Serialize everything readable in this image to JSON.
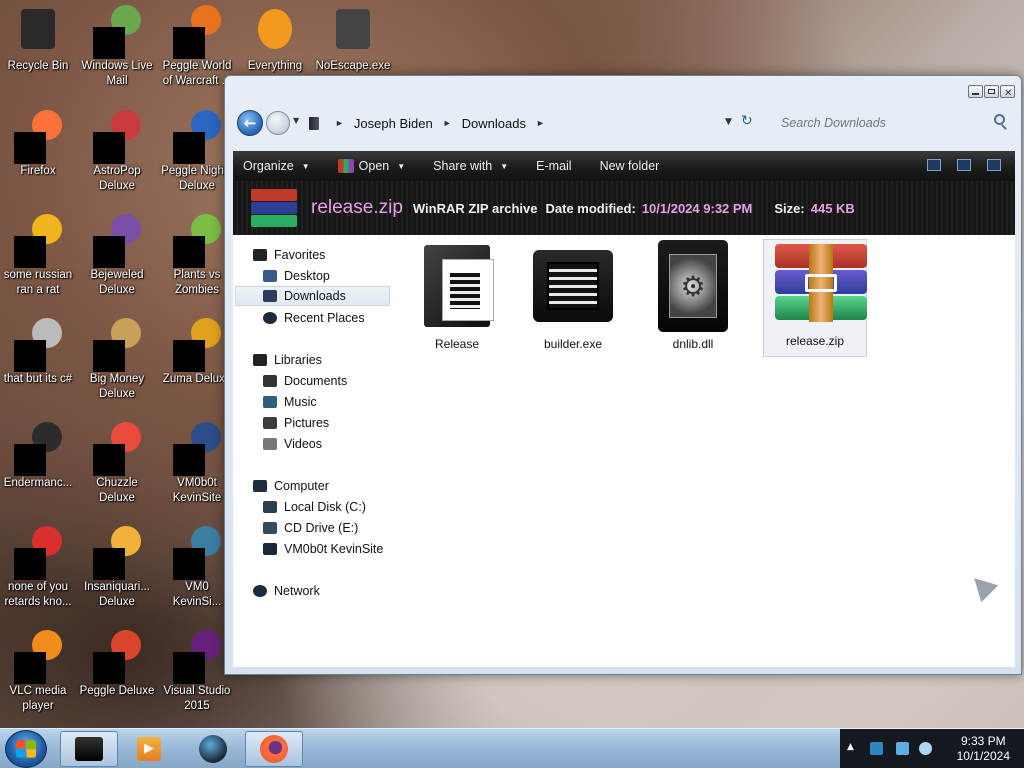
{
  "desktop": {
    "icons": [
      {
        "label": "Recycle Bin",
        "color": "#2a2a2a"
      },
      {
        "label": "Windows Live\nMail",
        "color": "#6aa84f"
      },
      {
        "label": "Peggle World\nof Warcraft ...",
        "color": "#e8731c"
      },
      {
        "label": "Everything",
        "color": "#f39a1e"
      },
      {
        "label": "NoEscape.exe",
        "color": "#444444"
      },
      {
        "label": "Firefox",
        "color": "#ff7139"
      },
      {
        "label": "AstroPop\nDeluxe",
        "color": "#cc3b3b"
      },
      {
        "label": "Peggle Nights\nDeluxe",
        "color": "#2b66c2"
      },
      {
        "label": "some russian\nran a rat",
        "color": "#f0b41c"
      },
      {
        "label": "Bejeweled\nDeluxe",
        "color": "#7b4fa8"
      },
      {
        "label": "Plants vs\nZombies",
        "color": "#7bbd45"
      },
      {
        "label": "that but its c#",
        "color": "#bbbbbb"
      },
      {
        "label": "Big Money\nDeluxe",
        "color": "#c7a05a"
      },
      {
        "label": "Zuma Deluxe",
        "color": "#e0a21c"
      },
      {
        "label": "Endermanc...",
        "color": "#2c2c2c"
      },
      {
        "label": "Chuzzle\nDeluxe",
        "color": "#e84b3c"
      },
      {
        "label": "VM0b0t\nKevinSite",
        "color": "#2c4d8a"
      },
      {
        "label": "none of you\nretards kno...",
        "color": "#d9302f"
      },
      {
        "label": "Insaniquari...\nDeluxe",
        "color": "#f2b13b"
      },
      {
        "label": "VM0\nKevinSi...",
        "color": "#3b7ea1"
      },
      {
        "label": "VLC media\nplayer",
        "color": "#f28c1c"
      },
      {
        "label": "Peggle Deluxe",
        "color": "#d9452b"
      },
      {
        "label": "Visual Studio\n2015",
        "color": "#68217a"
      }
    ]
  },
  "window": {
    "breadcrumb": [
      "Joseph Biden",
      "Downloads"
    ],
    "search_placeholder": "Search Downloads",
    "toolbar": {
      "organize": "Organize",
      "open": "Open",
      "share_with": "Share with",
      "email": "E-mail",
      "new_folder": "New folder"
    },
    "details": {
      "name": "release.zip",
      "type": "WinRAR ZIP archive",
      "date_label": "Date modified:",
      "date_value": "10/1/2024 9:32 PM",
      "size_label": "Size:",
      "size_value": "445 KB"
    },
    "nav": {
      "favorites": "Favorites",
      "desktop": "Desktop",
      "downloads": "Downloads",
      "recent_places": "Recent Places",
      "libraries": "Libraries",
      "documents": "Documents",
      "music": "Music",
      "pictures": "Pictures",
      "videos": "Videos",
      "computer": "Computer",
      "local_disk": "Local Disk (C:)",
      "cd_drive": "CD Drive (E:)",
      "vm_drive": "VM0b0t KevinSite",
      "network": "Network"
    },
    "files": [
      {
        "name": "Release",
        "icon": "folder-icon"
      },
      {
        "name": "builder.exe",
        "icon": "exe-icon"
      },
      {
        "name": "dnlib.dll",
        "icon": "dll-icon"
      },
      {
        "name": "release.zip",
        "icon": "winrar-icon"
      }
    ]
  },
  "taskbar": {
    "time": "9:33 PM",
    "date": "10/1/2024"
  },
  "colors": {
    "accent_pink": "#e6a0e8",
    "toolbar_dark": "#1e1e1e",
    "taskbar_blue": "#99b8d6"
  }
}
